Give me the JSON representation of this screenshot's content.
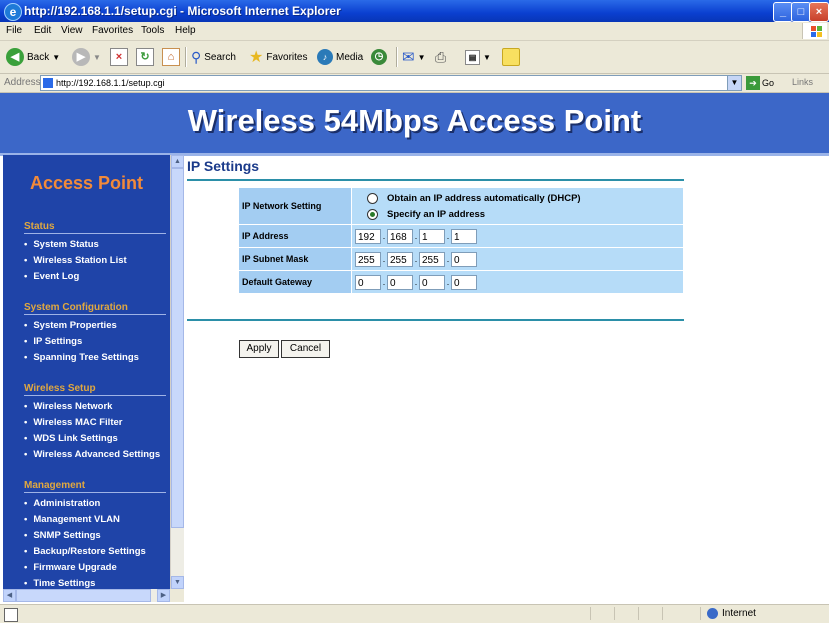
{
  "window": {
    "title": "http://192.168.1.1/setup.cgi - Microsoft Internet Explorer",
    "minimize": "_",
    "maximize": "□",
    "close": "×"
  },
  "menu": [
    "File",
    "Edit",
    "View",
    "Favorites",
    "Tools",
    "Help"
  ],
  "toolbar": {
    "back": "Back",
    "search": "Search",
    "favorites": "Favorites",
    "media": "Media"
  },
  "address": {
    "label": "Address",
    "url": "http://192.168.1.1/setup.cgi",
    "go": "Go",
    "links": "Links"
  },
  "banner": {
    "title": "Wireless 54Mbps Access Point"
  },
  "sidebar": {
    "heading": "Access Point",
    "sections": [
      {
        "title": "Status",
        "items": [
          "System Status",
          "Wireless Station List",
          "Event Log"
        ]
      },
      {
        "title": "System Configuration",
        "items": [
          "System Properties",
          "IP Settings",
          "Spanning Tree Settings"
        ]
      },
      {
        "title": "Wireless Setup",
        "items": [
          "Wireless Network",
          "Wireless MAC Filter",
          "WDS Link Settings",
          "Wireless Advanced Settings"
        ]
      },
      {
        "title": "Management",
        "items": [
          "Administration",
          "Management VLAN",
          "SNMP Settings",
          "Backup/Restore Settings",
          "Firmware Upgrade",
          "Time Settings"
        ]
      }
    ]
  },
  "content": {
    "heading": "IP Settings",
    "network_setting_label": "IP Network Setting",
    "option_dhcp": "Obtain an IP address automatically (DHCP)",
    "option_static": "Specify an IP address",
    "selected_option": "static",
    "ip_address_label": "IP Address",
    "ip_address": [
      "192",
      "168",
      "1",
      "1"
    ],
    "subnet_label": "IP Subnet Mask",
    "subnet": [
      "255",
      "255",
      "255",
      "0"
    ],
    "gateway_label": "Default Gateway",
    "gateway": [
      "0",
      "0",
      "0",
      "0"
    ],
    "octet_separator": ".",
    "apply": "Apply",
    "cancel": "Cancel"
  },
  "status": {
    "zone": "Internet"
  },
  "colors": {
    "banner": "#3c67c8",
    "sidebar": "#1f44a8",
    "accent_orange": "#f28a3a",
    "section_gold": "#e0a840",
    "table_cell": "#a8d2f5",
    "rule": "#2b8fa8"
  }
}
